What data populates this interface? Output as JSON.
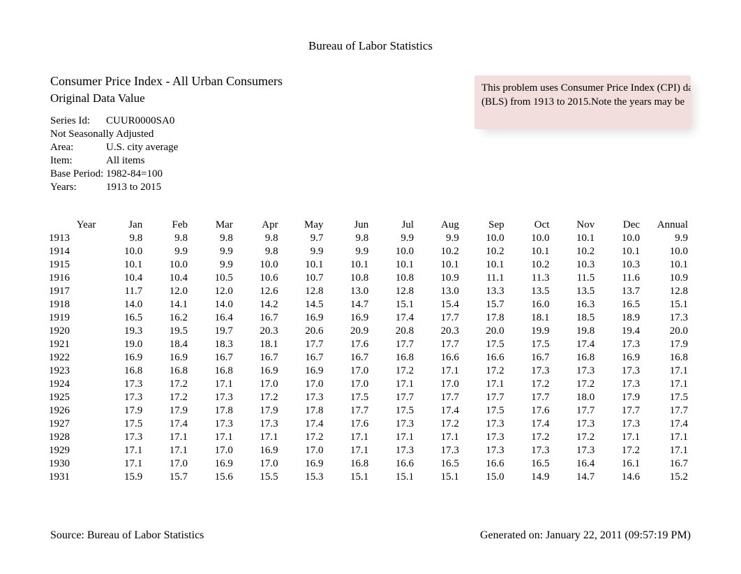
{
  "title": "Bureau of Labor Statistics",
  "subtitle1": "Consumer Price Index - All Urban Consumers",
  "subtitle2": "Original Data Value",
  "meta": {
    "series_label": "Series Id:",
    "series_value": "CUUR0000SA0",
    "adjustment": "Not Seasonally Adjusted",
    "area_label": "Area:",
    "area_value": "U.S. city average",
    "item_label": "Item:",
    "item_value": "All items",
    "base_label": "Base Period:",
    "base_value": "1982-84=100",
    "years_label": "Years:",
    "years_value": "1913 to 2015"
  },
  "note": {
    "line1": "This problem uses Consumer Price Index (CPI) da",
    "line2": "(BLS) from 1913 to 2015.Note the years may be"
  },
  "columns": [
    "Year",
    "Jan",
    "Feb",
    "Mar",
    "Apr",
    "May",
    "Jun",
    "Jul",
    "Aug",
    "Sep",
    "Oct",
    "Nov",
    "Dec",
    "Annual"
  ],
  "rows": [
    {
      "year": "1913",
      "v": [
        "9.8",
        "9.8",
        "9.8",
        "9.8",
        "9.7",
        "9.8",
        "9.9",
        "9.9",
        "10.0",
        "10.0",
        "10.1",
        "10.0",
        "9.9"
      ]
    },
    {
      "year": "1914",
      "v": [
        "10.0",
        "9.9",
        "9.9",
        "9.8",
        "9.9",
        "9.9",
        "10.0",
        "10.2",
        "10.2",
        "10.1",
        "10.2",
        "10.1",
        "10.0"
      ]
    },
    {
      "year": "1915",
      "v": [
        "10.1",
        "10.0",
        "9.9",
        "10.0",
        "10.1",
        "10.1",
        "10.1",
        "10.1",
        "10.1",
        "10.2",
        "10.3",
        "10.3",
        "10.1"
      ]
    },
    {
      "year": "1916",
      "v": [
        "10.4",
        "10.4",
        "10.5",
        "10.6",
        "10.7",
        "10.8",
        "10.8",
        "10.9",
        "11.1",
        "11.3",
        "11.5",
        "11.6",
        "10.9"
      ]
    },
    {
      "year": "1917",
      "v": [
        "11.7",
        "12.0",
        "12.0",
        "12.6",
        "12.8",
        "13.0",
        "12.8",
        "13.0",
        "13.3",
        "13.5",
        "13.5",
        "13.7",
        "12.8"
      ]
    },
    {
      "year": "1918",
      "v": [
        "14.0",
        "14.1",
        "14.0",
        "14.2",
        "14.5",
        "14.7",
        "15.1",
        "15.4",
        "15.7",
        "16.0",
        "16.3",
        "16.5",
        "15.1"
      ]
    },
    {
      "year": "1919",
      "v": [
        "16.5",
        "16.2",
        "16.4",
        "16.7",
        "16.9",
        "16.9",
        "17.4",
        "17.7",
        "17.8",
        "18.1",
        "18.5",
        "18.9",
        "17.3"
      ]
    },
    {
      "year": "1920",
      "v": [
        "19.3",
        "19.5",
        "19.7",
        "20.3",
        "20.6",
        "20.9",
        "20.8",
        "20.3",
        "20.0",
        "19.9",
        "19.8",
        "19.4",
        "20.0"
      ]
    },
    {
      "year": "1921",
      "v": [
        "19.0",
        "18.4",
        "18.3",
        "18.1",
        "17.7",
        "17.6",
        "17.7",
        "17.7",
        "17.5",
        "17.5",
        "17.4",
        "17.3",
        "17.9"
      ]
    },
    {
      "year": "1922",
      "v": [
        "16.9",
        "16.9",
        "16.7",
        "16.7",
        "16.7",
        "16.7",
        "16.8",
        "16.6",
        "16.6",
        "16.7",
        "16.8",
        "16.9",
        "16.8"
      ]
    },
    {
      "year": "1923",
      "v": [
        "16.8",
        "16.8",
        "16.8",
        "16.9",
        "16.9",
        "17.0",
        "17.2",
        "17.1",
        "17.2",
        "17.3",
        "17.3",
        "17.3",
        "17.1"
      ]
    },
    {
      "year": "1924",
      "v": [
        "17.3",
        "17.2",
        "17.1",
        "17.0",
        "17.0",
        "17.0",
        "17.1",
        "17.0",
        "17.1",
        "17.2",
        "17.2",
        "17.3",
        "17.1"
      ]
    },
    {
      "year": "1925",
      "v": [
        "17.3",
        "17.2",
        "17.3",
        "17.2",
        "17.3",
        "17.5",
        "17.7",
        "17.7",
        "17.7",
        "17.7",
        "18.0",
        "17.9",
        "17.5"
      ]
    },
    {
      "year": "1926",
      "v": [
        "17.9",
        "17.9",
        "17.8",
        "17.9",
        "17.8",
        "17.7",
        "17.5",
        "17.4",
        "17.5",
        "17.6",
        "17.7",
        "17.7",
        "17.7"
      ]
    },
    {
      "year": "1927",
      "v": [
        "17.5",
        "17.4",
        "17.3",
        "17.3",
        "17.4",
        "17.6",
        "17.3",
        "17.2",
        "17.3",
        "17.4",
        "17.3",
        "17.3",
        "17.4"
      ]
    },
    {
      "year": "1928",
      "v": [
        "17.3",
        "17.1",
        "17.1",
        "17.1",
        "17.2",
        "17.1",
        "17.1",
        "17.1",
        "17.3",
        "17.2",
        "17.2",
        "17.1",
        "17.1"
      ]
    },
    {
      "year": "1929",
      "v": [
        "17.1",
        "17.1",
        "17.0",
        "16.9",
        "17.0",
        "17.1",
        "17.3",
        "17.3",
        "17.3",
        "17.3",
        "17.3",
        "17.2",
        "17.1"
      ]
    },
    {
      "year": "1930",
      "v": [
        "17.1",
        "17.0",
        "16.9",
        "17.0",
        "16.9",
        "16.8",
        "16.6",
        "16.5",
        "16.6",
        "16.5",
        "16.4",
        "16.1",
        "16.7"
      ]
    },
    {
      "year": "1931",
      "v": [
        "15.9",
        "15.7",
        "15.6",
        "15.5",
        "15.3",
        "15.1",
        "15.1",
        "15.1",
        "15.0",
        "14.9",
        "14.7",
        "14.6",
        "15.2"
      ]
    }
  ],
  "footer": {
    "source": "Source: Bureau of Labor Statistics",
    "generated": "Generated on: January 22, 2011 (09:57:19 PM)"
  }
}
